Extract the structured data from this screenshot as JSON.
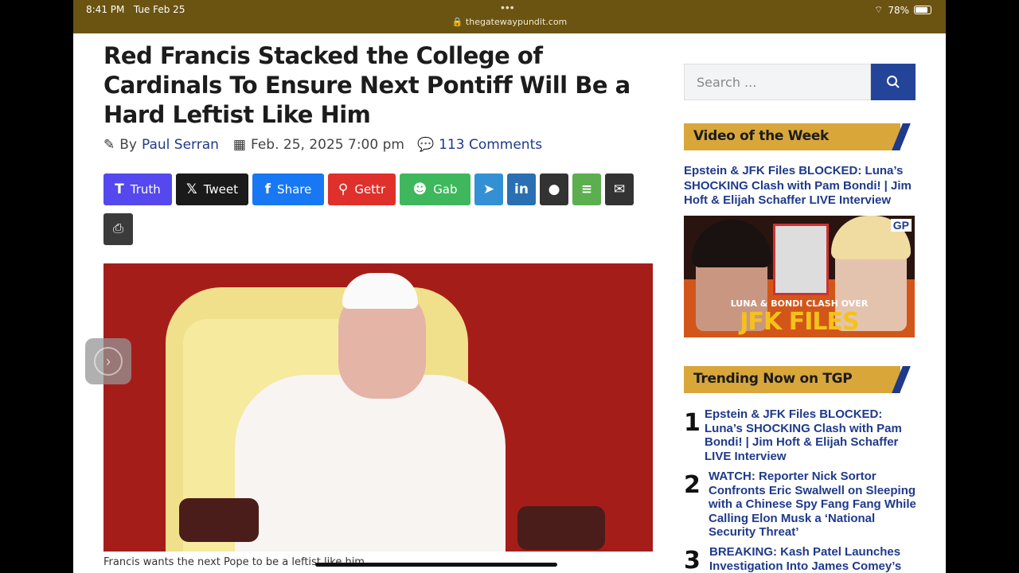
{
  "status_bar": {
    "time": "8:41 PM",
    "date": "Tue Feb 25",
    "url": "thegatewaypundit.com",
    "battery": "78%",
    "dots": "•••"
  },
  "article": {
    "title": "Red Francis Stacked the College of Cardinals To Ensure Next Pontiff Will Be a Hard Leftist Like Him",
    "by": "By",
    "author": "Paul Serran",
    "date": "Feb. 25, 2025 7:00 pm",
    "comments": "113 Comments",
    "caption": "Francis wants the next Pope to be a leftist like him."
  },
  "share_buttons": [
    {
      "label": "Truth",
      "icon": "truth-social-icon",
      "glyph": "T",
      "color": "#5448ee"
    },
    {
      "label": "Tweet",
      "icon": "x-icon",
      "glyph": "𝕏",
      "color": "#1a1a1a"
    },
    {
      "label": "Share",
      "icon": "facebook-icon",
      "glyph": "f",
      "color": "#1877f2"
    },
    {
      "label": "Gettr",
      "icon": "gettr-icon",
      "glyph": "⚲",
      "color": "#e0302b"
    },
    {
      "label": "Gab",
      "icon": "gab-icon",
      "glyph": "☻",
      "color": "#3fb75d"
    },
    {
      "label": "",
      "icon": "telegram-icon",
      "glyph": "➤",
      "color": "#3390d4"
    },
    {
      "label": "",
      "icon": "linkedin-icon",
      "glyph": "in",
      "color": "#2a6fb3"
    },
    {
      "label": "",
      "icon": "comment-icon",
      "glyph": "●",
      "color": "#333333"
    },
    {
      "label": "",
      "icon": "sms-icon",
      "glyph": "≡",
      "color": "#5cae4f"
    },
    {
      "label": "",
      "icon": "email-icon",
      "glyph": "✉",
      "color": "#333333"
    }
  ],
  "print_icon": "print-icon",
  "sidebar": {
    "search_placeholder": "Search ...",
    "video_heading": "Video of the Week",
    "video_link": "Epstein & JFK Files BLOCKED: Luna’s SHOCKING Clash with Pam Bondi! | Jim Hoft & Elijah Schaffer LIVE Interview",
    "thumb_badge": "GP",
    "thumb_line1": "LUNA & BONDI CLASH OVER",
    "thumb_line2": "JFK FILES",
    "trending_heading": "Trending Now on TGP",
    "trending": [
      {
        "num": "1",
        "text": "Epstein & JFK Files BLOCKED: Luna’s SHOCKING Clash with Pam Bondi! | Jim Hoft & Elijah Schaffer LIVE Interview"
      },
      {
        "num": "2",
        "text": "WATCH: Reporter Nick Sortor Confronts Eric Swalwell on Sleeping with a Chinese Spy Fang Fang While Calling Elon Musk a ‘National Security Threat’"
      },
      {
        "num": "3",
        "text": "BREAKING: Kash Patel Launches Investigation Into James Comey’s"
      }
    ]
  },
  "colors": {
    "brand_blue": "#1f3a8a",
    "banner_gold": "#d9a63a",
    "statusbar": "#6b5312"
  }
}
